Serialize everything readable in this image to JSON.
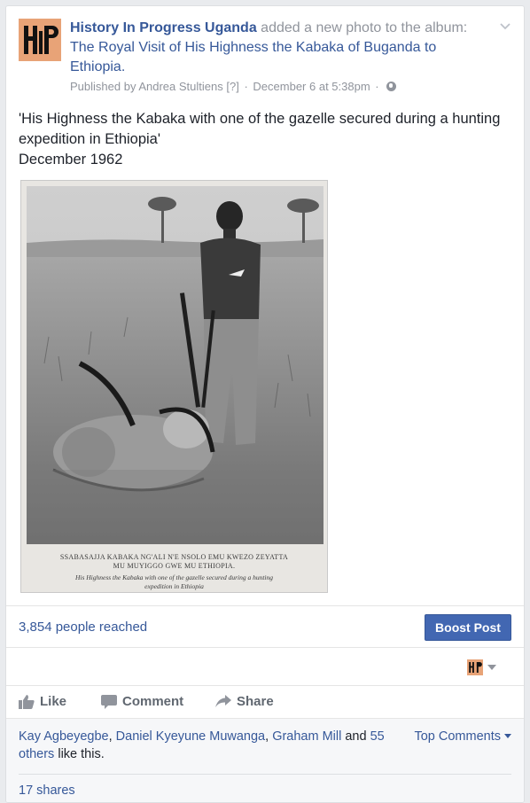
{
  "post": {
    "page_name": "History In Progress Uganda",
    "action_text": "added a new photo to the album:",
    "album_name": "The Royal Visit of His Highness the Kabaka of Buganda to Ethiopia.",
    "published_by": "Published by Andrea Stultiens",
    "help_marker": "[?]",
    "timestamp": "December 6 at 5:38pm",
    "dot": "·",
    "avatar_logo_text": "HiP",
    "caption_line1": "'His Highness the Kabaka with one of the gazelle secured during a hunting expedition in Ethiopia'",
    "caption_line2": "December 1962"
  },
  "photo": {
    "plate_caption_luganda": "SSABASAJJA KABAKA NG'ALI N'E NSOLO EMU KWEZO ZEYATTA MU MUYIGGO GWE MU ETHIOPIA.",
    "plate_caption_english": "His Highness the Kabaka with one of the gazelle secured during a hunting expedition in Ethiopia"
  },
  "insights": {
    "reach": "3,854 people reached",
    "boost_label": "Boost Post"
  },
  "actions": {
    "like": "Like",
    "comment": "Comment",
    "share": "Share"
  },
  "social": {
    "liker1": "Kay Agbeyegbe",
    "comma1": ", ",
    "liker2": "Daniel Kyeyune Muwanga",
    "comma2": ", ",
    "liker3": "Graham Mill",
    "and_text": " and ",
    "others": "55 others",
    "like_this": " like this.",
    "top_comments": "Top Comments",
    "shares": "17 shares"
  },
  "colors": {
    "link": "#365899",
    "boost_bg": "#4267b2",
    "avatar_bg": "#e8a377"
  }
}
